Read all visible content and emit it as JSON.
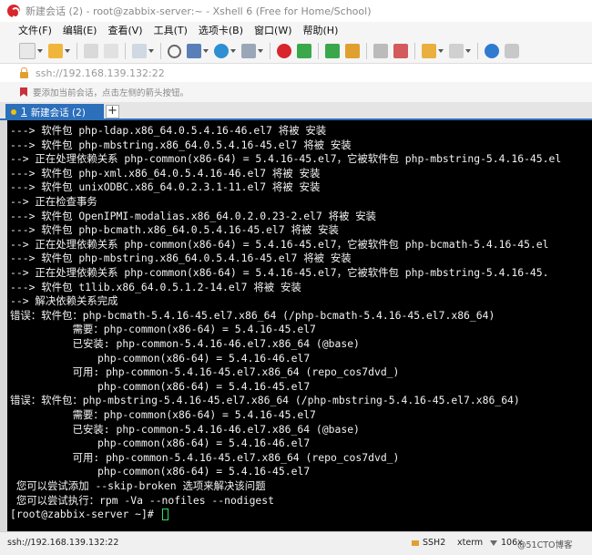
{
  "window": {
    "title": "新建会话 (2) - root@zabbix-server:~ - Xshell 6 (Free for Home/School)"
  },
  "menu": [
    "文件(F)",
    "编辑(E)",
    "查看(V)",
    "工具(T)",
    "选项卡(B)",
    "窗口(W)",
    "帮助(H)"
  ],
  "address": {
    "text": "ssh://192.168.139.132:22"
  },
  "hint": {
    "text": "要添加当前会话，点击左侧的箭头按钮。"
  },
  "tab": {
    "number": "1",
    "label": "新建会话 (2)",
    "add_label": "+"
  },
  "terminal": {
    "lines": [
      "---> 软件包 php-ldap.x86_64.0.5.4.16-46.el7 将被 安装",
      "---> 软件包 php-mbstring.x86_64.0.5.4.16-45.el7 将被 安装",
      "--> 正在处理依赖关系 php-common(x86-64) = 5.4.16-45.el7，它被软件包 php-mbstring-5.4.16-45.el",
      "---> 软件包 php-xml.x86_64.0.5.4.16-46.el7 将被 安装",
      "---> 软件包 unixODBC.x86_64.0.2.3.1-11.el7 将被 安装",
      "--> 正在检查事务",
      "---> 软件包 OpenIPMI-modalias.x86_64.0.2.0.23-2.el7 将被 安装",
      "---> 软件包 php-bcmath.x86_64.0.5.4.16-45.el7 将被 安装",
      "--> 正在处理依赖关系 php-common(x86-64) = 5.4.16-45.el7，它被软件包 php-bcmath-5.4.16-45.el",
      "---> 软件包 php-mbstring.x86_64.0.5.4.16-45.el7 将被 安装",
      "--> 正在处理依赖关系 php-common(x86-64) = 5.4.16-45.el7，它被软件包 php-mbstring-5.4.16-45.",
      "---> 软件包 t1lib.x86_64.0.5.1.2-14.el7 将被 安装",
      "--> 解决依赖关系完成",
      "错误：软件包：php-bcmath-5.4.16-45.el7.x86_64 (/php-bcmath-5.4.16-45.el7.x86_64)",
      "          需要：php-common(x86-64) = 5.4.16-45.el7",
      "          已安装: php-common-5.4.16-46.el7.x86_64 (@base)",
      "              php-common(x86-64) = 5.4.16-46.el7",
      "          可用: php-common-5.4.16-45.el7.x86_64 (repo_cos7dvd_)",
      "              php-common(x86-64) = 5.4.16-45.el7",
      "错误：软件包：php-mbstring-5.4.16-45.el7.x86_64 (/php-mbstring-5.4.16-45.el7.x86_64)",
      "          需要：php-common(x86-64) = 5.4.16-45.el7",
      "          已安装: php-common-5.4.16-46.el7.x86_64 (@base)",
      "              php-common(x86-64) = 5.4.16-46.el7",
      "          可用: php-common-5.4.16-45.el7.x86_64 (repo_cos7dvd_)",
      "              php-common(x86-64) = 5.4.16-45.el7",
      " 您可以尝试添加 --skip-broken 选项来解决该问题",
      " 您可以尝试执行：rpm -Va --nofiles --nodigest",
      "[root@zabbix-server ~]# "
    ]
  },
  "status": {
    "address": "ssh://192.168.139.132:22",
    "protocol": "SSH2",
    "terminal_type": "xterm",
    "size": "106x",
    "watermark": "@51CTO博客"
  },
  "colors": {
    "accent": "#2c6fbb",
    "terminal_bg": "#000000",
    "terminal_fg": "#f2f2f2",
    "cursor": "#2fe06d"
  }
}
